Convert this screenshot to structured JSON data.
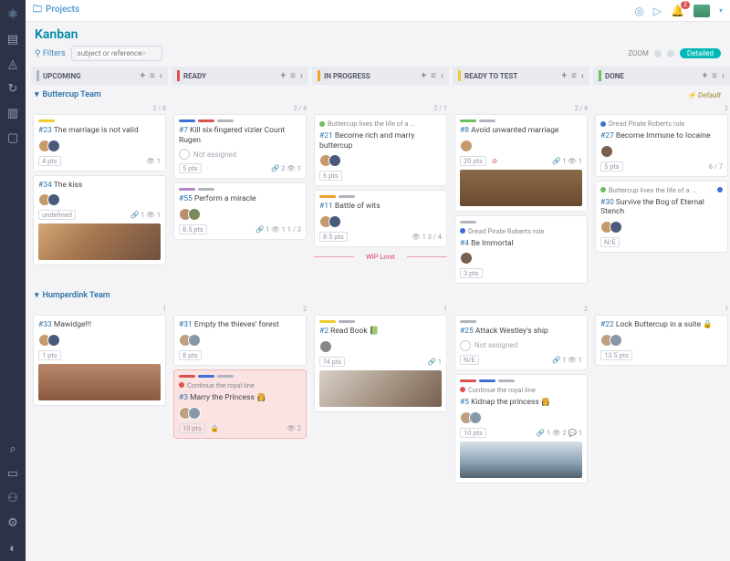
{
  "breadcrumb": {
    "label": "Projects"
  },
  "notifications": {
    "count": "2"
  },
  "page": {
    "title": "Kanban"
  },
  "filters": {
    "label": "Filters",
    "placeholder": "subject or reference"
  },
  "zoom": {
    "label": "ZOOM",
    "detailed": "Detailed"
  },
  "columns": [
    {
      "name": "UPCOMING",
      "color": "#b0b4bc"
    },
    {
      "name": "READY",
      "color": "#d9534f"
    },
    {
      "name": "IN PROGRESS",
      "color": "#f0a030"
    },
    {
      "name": "READY TO TEST",
      "color": "#f0ca30"
    },
    {
      "name": "DONE",
      "color": "#6cbf5a"
    }
  ],
  "swimlanes": [
    {
      "name": "Buttercup Team",
      "default_label": "Default"
    },
    {
      "name": "Humperdink Team"
    }
  ],
  "wip_label": "WIP Limit",
  "roles": {
    "buttercup": {
      "label": "Buttercup lives the life of a ...",
      "color": "#6cbf5a"
    },
    "dread": {
      "label": "Dread Pirate Roberts role",
      "color": "#3f6fd6"
    },
    "continue": {
      "label": "Continue the royal line",
      "color": "#d9534f"
    }
  },
  "not_assigned": "Not assigned",
  "cells": {
    "s0": {
      "c0": {
        "meta": "2 / 8",
        "cards": [
          {
            "ref": "#23",
            "title": "The marriage is not valid",
            "tags": [
              "#f0ca30"
            ],
            "av": [
              "#c79a6b",
              "#4a5a7a"
            ],
            "pts": "4 pts",
            "right": "👁 1"
          },
          {
            "ref": "#34",
            "title": "The kiss",
            "av": [
              "#c79a6b",
              "#4a5a7a"
            ],
            "right": "🔗 1 👁 1",
            "thumb": "linear-gradient(135deg,#d4a878,#a87850 40%,#705040)"
          }
        ]
      },
      "c1": {
        "meta": "2 / 4",
        "cards": [
          {
            "ref": "#7",
            "title": "Kill six-fingered vizier Count Rugen",
            "tags": [
              "#3f6fd6",
              "#d9534f",
              "#b0b4bc"
            ],
            "na": true,
            "pts": "5 pts",
            "right": "🔗 2 👁 1"
          },
          {
            "ref": "#55",
            "title": "Perform a miracle",
            "tags": [
              "#b088c8",
              "#b0b4bc"
            ],
            "av": [
              "#b89070",
              "#7a8a5a"
            ],
            "pts": "8.5 pts",
            "right": "🔗 1 👁 1  1 / 3"
          }
        ]
      },
      "c2": {
        "meta": "2 / 1",
        "cards": [
          {
            "ref": "#21",
            "title": "Become rich and marry buttercup",
            "role": "buttercup",
            "av": [
              "#c79a6b",
              "#4a5a7a"
            ],
            "pts": "6 pts"
          },
          {
            "ref": "#11",
            "title": "Battle of wits",
            "tags": [
              "#f0a030",
              "#b0b4bc"
            ],
            "av": [
              "#c79a6b",
              "#4a5a7a"
            ],
            "pts": "8.5 pts",
            "right": "👁 1  3 / 4"
          }
        ],
        "wip": true
      },
      "c3": {
        "meta": "2 / 4",
        "cards": [
          {
            "ref": "#8",
            "title": "Avoid unwanted marriage",
            "tags": [
              "#6cbf5a",
              "#b0b4bc"
            ],
            "av": [
              "#c79a6b"
            ],
            "pts": "20 pts",
            "pts_warn": true,
            "right": "🔗 1 👁 1",
            "thumb": "linear-gradient(180deg,#8a6a48,#6a4a30)"
          },
          {
            "ref": "#4",
            "title": "Be Immortal",
            "tags": [
              "#b0b4bc"
            ],
            "role": "dread",
            "av": [
              "#786050"
            ],
            "pts": "3 pts"
          }
        ]
      },
      "c4": {
        "meta": "2",
        "cards": [
          {
            "ref": "#27",
            "title": "Become Immune to Iocaine",
            "role": "dread",
            "av": [
              "#786050"
            ],
            "pts": "5 pts",
            "right": "6 / 7"
          },
          {
            "ref": "#30",
            "title": "Survive the Bog of Eternal Stench",
            "role": "buttercup",
            "role_extra": true,
            "av": [
              "#c79a6b",
              "#4a5a7a"
            ],
            "pts": "N/E"
          }
        ]
      }
    },
    "s1": {
      "c0": {
        "meta": "1",
        "cards": [
          {
            "ref": "#33",
            "title": "Mawidge!!!",
            "av": [
              "#c79a6b",
              "#4a5a7a"
            ],
            "pts": "1 pts",
            "thumb": "linear-gradient(180deg,#b8866a,#8a5a40)"
          }
        ]
      },
      "c1": {
        "meta": "2",
        "cards": [
          {
            "ref": "#31",
            "title": "Empty the thieves' forest",
            "av": [
              "#c0a080",
              "#8898a8"
            ],
            "pts": "8 pts"
          },
          {
            "ref": "#3",
            "title": "Marry the Princess 👸",
            "tags": [
              "#d9534f",
              "#3f6fd6",
              "#b0b4bc"
            ],
            "role": "continue",
            "av": [
              "#c0a080",
              "#8898a8"
            ],
            "pts": "10 pts",
            "pts_lock": true,
            "right": "👁 2",
            "blocked": true
          }
        ]
      },
      "c2": {
        "meta": "1",
        "cards": [
          {
            "ref": "#2",
            "title": "Read Book 📗",
            "tags": [
              "#f0ca30",
              "#b0b4bc"
            ],
            "av": [
              "#888"
            ],
            "pts": "?4 pts",
            "right": "🔗 1",
            "thumb": "linear-gradient(135deg,#d8d0c8,#a89888 50%,#786050)"
          }
        ]
      },
      "c3": {
        "meta": "2",
        "cards": [
          {
            "ref": "#25",
            "title": "Attack Westley's ship",
            "tags": [
              "#b0b4bc"
            ],
            "na": true,
            "pts": "N/E",
            "right": "🔗 1 👁 1"
          },
          {
            "ref": "#5",
            "title": "Kidnap the princess 👸",
            "tags": [
              "#d9534f",
              "#3f6fd6",
              "#b0b4bc"
            ],
            "role": "continue",
            "av": [
              "#c0a080",
              "#8898a8"
            ],
            "pts": "10 pts",
            "right": "🔗 1 👁 2 💬 1",
            "thumb": "linear-gradient(180deg,#d8e0e8,#88a0b0 60%,#506070)"
          }
        ]
      },
      "c4": {
        "meta": "1",
        "cards": [
          {
            "ref": "#22",
            "title": "Lock Buttercup in a suite 🔒",
            "av": [
              "#c0a080",
              "#8898a8"
            ],
            "pts": "13.5 pts"
          }
        ]
      }
    }
  }
}
